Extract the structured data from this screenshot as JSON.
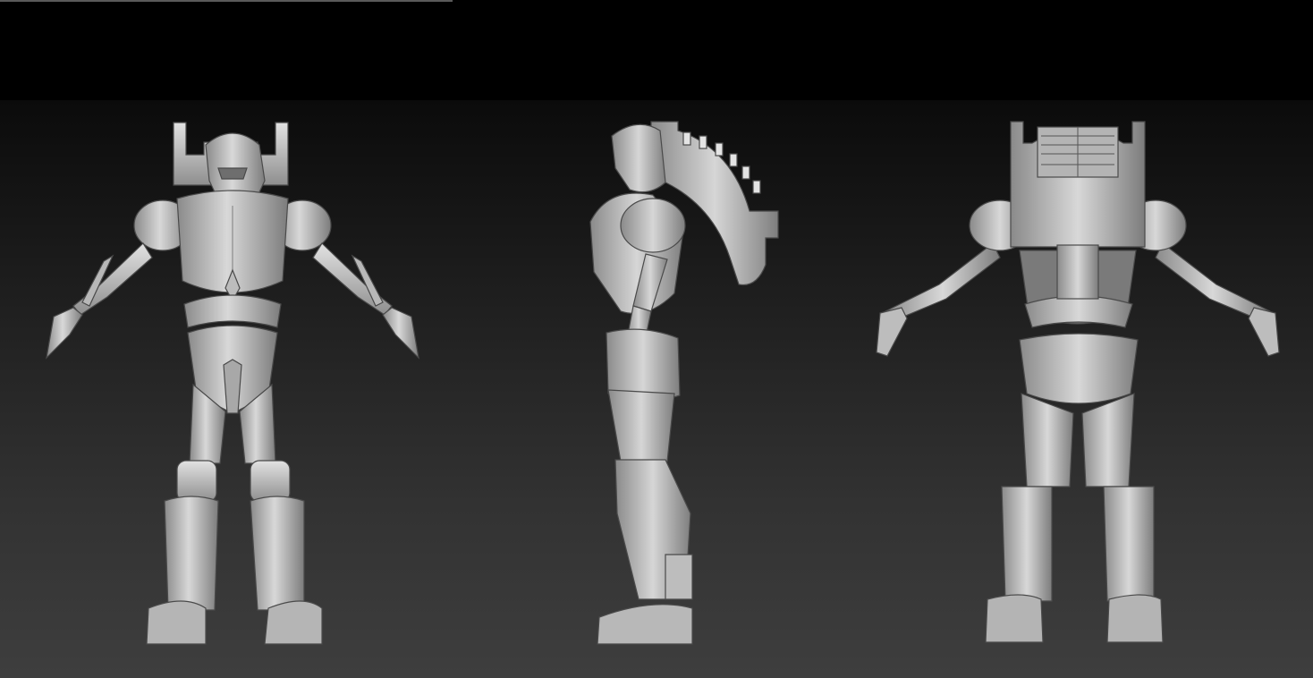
{
  "viewport": {
    "background": "#000000",
    "canvas_gradient": [
      "#0b0b0b",
      "#1f1f1f",
      "#323232",
      "#3e3e3e"
    ],
    "top_rule_color": "#5a5a5a"
  },
  "figures": [
    {
      "view": "front",
      "material_color": "#c9c9c9"
    },
    {
      "view": "side",
      "material_color": "#c9c9c9"
    },
    {
      "view": "back",
      "material_color": "#c9c9c9"
    }
  ]
}
